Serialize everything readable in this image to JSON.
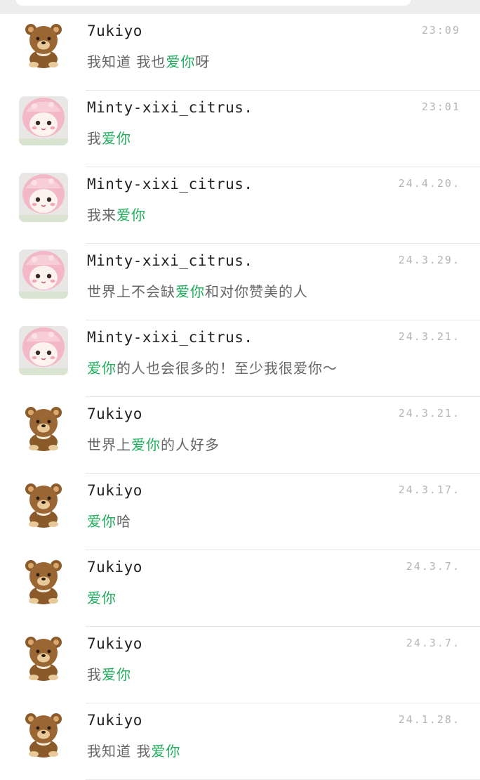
{
  "chats": [
    {
      "name": "7ukiyo",
      "avatar": "teddy-bear",
      "time": "23:09",
      "message": [
        {
          "t": "我知道 我也",
          "h": false
        },
        {
          "t": "爱你",
          "h": true
        },
        {
          "t": "呀",
          "h": false
        }
      ]
    },
    {
      "name": "Minty-xixi_citrus.",
      "avatar": "pink-doll",
      "time": "23:01",
      "message": [
        {
          "t": "我",
          "h": false
        },
        {
          "t": "爱你",
          "h": true
        }
      ]
    },
    {
      "name": "Minty-xixi_citrus.",
      "avatar": "pink-doll",
      "time": "24.4.20.",
      "message": [
        {
          "t": "我来",
          "h": false
        },
        {
          "t": "爱你",
          "h": true
        }
      ]
    },
    {
      "name": "Minty-xixi_citrus.",
      "avatar": "pink-doll",
      "time": "24.3.29.",
      "message": [
        {
          "t": "世界上不会缺",
          "h": false
        },
        {
          "t": "爱你",
          "h": true
        },
        {
          "t": "和对你赞美的人",
          "h": false
        }
      ]
    },
    {
      "name": "Minty-xixi_citrus.",
      "avatar": "pink-doll",
      "time": "24.3.21.",
      "message": [
        {
          "t": "爱你",
          "h": true
        },
        {
          "t": "的人也会很多的！至少我很爱你～",
          "h": false
        }
      ]
    },
    {
      "name": "7ukiyo",
      "avatar": "teddy-bear",
      "time": "24.3.21.",
      "message": [
        {
          "t": "世界上",
          "h": false
        },
        {
          "t": "爱你",
          "h": true
        },
        {
          "t": "的人好多",
          "h": false
        }
      ]
    },
    {
      "name": "7ukiyo",
      "avatar": "teddy-bear",
      "time": "24.3.17.",
      "message": [
        {
          "t": "爱你",
          "h": true
        },
        {
          "t": "哈",
          "h": false
        }
      ]
    },
    {
      "name": "7ukiyo",
      "avatar": "teddy-bear",
      "time": "24.3.7.",
      "message": [
        {
          "t": "爱你",
          "h": true
        }
      ]
    },
    {
      "name": "7ukiyo",
      "avatar": "teddy-bear",
      "time": "24.3.7.",
      "message": [
        {
          "t": "我",
          "h": false
        },
        {
          "t": "爱你",
          "h": true
        }
      ]
    },
    {
      "name": "7ukiyo",
      "avatar": "teddy-bear",
      "time": "24.1.28.",
      "message": [
        {
          "t": "我知道 我",
          "h": false
        },
        {
          "t": "爱你",
          "h": true
        }
      ]
    }
  ],
  "colors": {
    "highlight": "#1fae5b",
    "name": "#222222",
    "message": "#666666",
    "time": "#b4b4b4"
  }
}
